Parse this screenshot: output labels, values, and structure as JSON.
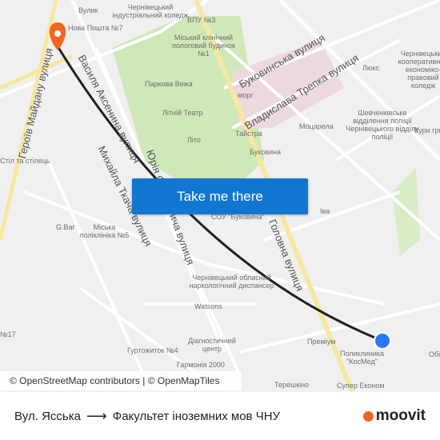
{
  "map": {
    "cta_label": "Take me there",
    "attribution": "© OpenStreetMap contributors | © OpenMapTiles",
    "route_color": "#222222",
    "origin_color": "#2979ff",
    "destination_color": "#f26522",
    "streets": [
      "Героїв Майдану вулиця",
      "Василя Аксенина вулиця",
      "Михайла Ткача вулиця",
      "Юрія Федьковича вулиця",
      "Буковинська вулиця",
      "Владислава Трепка вулиця",
      "Головна вулиця"
    ],
    "places": [
      "Вулик",
      "Чернівецький індустріальний коледж",
      "ВПУ №3",
      "Нова Пошта №7",
      "Міський клінічний пологовий будинок №1",
      "Паркова Вежа",
      "Літній Театр",
      "Літо",
      "морг",
      "Тайстра",
      "Буковина",
      "Моцарела",
      "Люкс",
      "Чернівецький кооперативний економіко-правовий коледж",
      "Шевченківське відділення поліції Чернівецького відділу поліції",
      "Кури гриль",
      "Стіл та стілець",
      "G.Bar",
      "Міська поліклініка №5",
      "СОУ \"Буковина\"",
      "Іва",
      "Чернівецький обласний наркологічний диспансер",
      "Watsons",
      "Діагностичний центр",
      "Гуртожиток №4",
      "Гармонія 2000",
      "Преміум",
      "Поликлиника \"КосМед\"",
      "Терешкіно",
      "Супер Економ",
      "№17",
      "Обі"
    ]
  },
  "footer": {
    "origin": "Вул. Ясська",
    "destination": "Факультет іноземних мов ЧНУ",
    "brand": "moovit"
  }
}
